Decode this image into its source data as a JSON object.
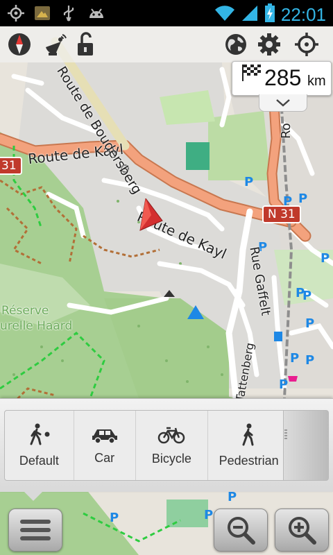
{
  "status_bar": {
    "time": "22:01",
    "icons": [
      "gps-icon",
      "notification-app-icon",
      "usb-icon",
      "android-debug-icon",
      "wifi-icon",
      "signal-icon",
      "battery-charging-icon"
    ]
  },
  "toolbar": {
    "left_icons": [
      "compass-icon",
      "satellite-dish-icon",
      "lock-open-icon"
    ],
    "right_icons": [
      "globe-icon",
      "gear-icon",
      "my-location-icon"
    ]
  },
  "distance": {
    "value": "285",
    "unit": "km"
  },
  "map_labels": {
    "route_de_kayl_1": "Route de Kayl",
    "route_de_kayl_2": "Route de Kayl",
    "route_de_boudersberg": "Route de Boudersberg",
    "rue_gaffelt": "Rue Gaffelt",
    "rue_tattenberg": "Rue Tattenberg",
    "n31_shield": "N 31",
    "shield_31": "31",
    "reserve_1": "Réserve",
    "reserve_2": "urelle Haard",
    "ro_fragment": "Ro"
  },
  "modes": [
    {
      "label": "Default",
      "icon": "walk-dot-icon"
    },
    {
      "label": "Car",
      "icon": "car-icon"
    },
    {
      "label": "Bicycle",
      "icon": "bicycle-icon"
    },
    {
      "label": "Pedestrian",
      "icon": "pedestrian-icon"
    }
  ],
  "bottom_buttons": {
    "menu": "menu-icon",
    "zoom_out": "zoom-out-icon",
    "zoom_in": "zoom-in-icon"
  },
  "colors": {
    "main_road": "#f3a27d",
    "forest": "#9ec98a",
    "urban": "#dddcd9",
    "parking": "#1e88e5",
    "clock": "#33b5e5",
    "location_arrow": "#d32f2f"
  }
}
